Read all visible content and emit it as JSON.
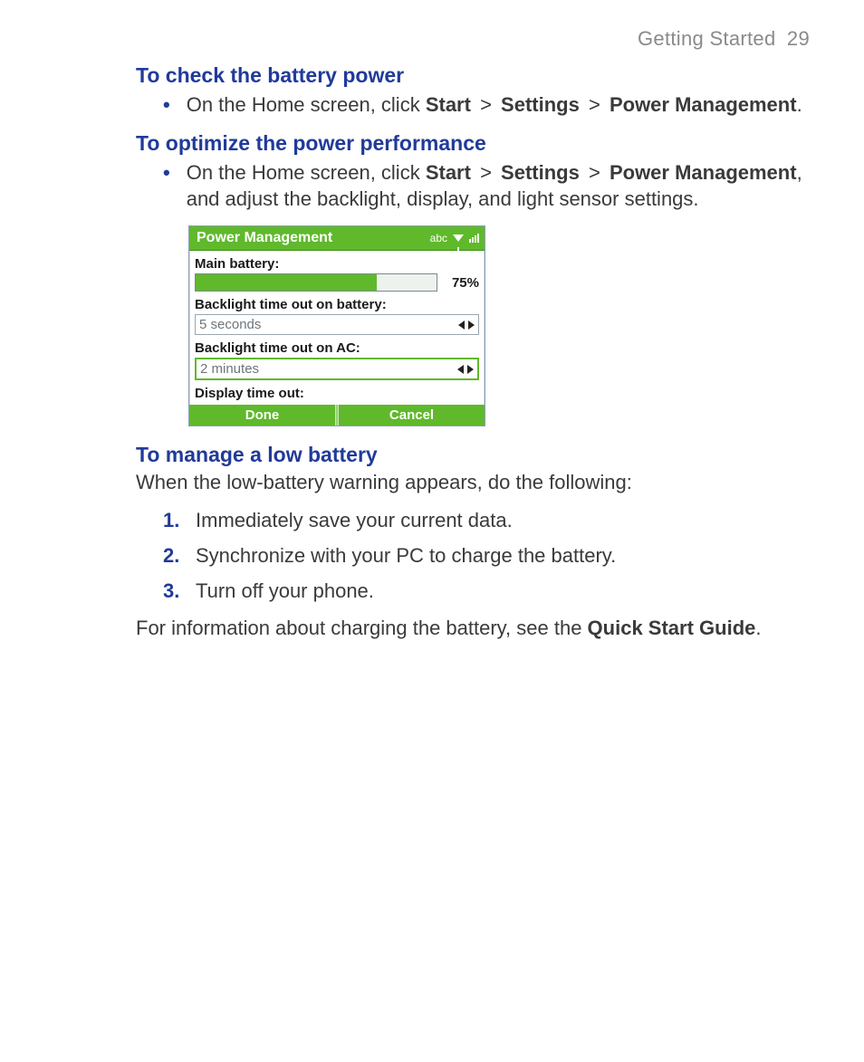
{
  "header": {
    "section": "Getting Started",
    "page": "29"
  },
  "sections": {
    "check": {
      "title": "To check the battery power",
      "bullet_prefix": "On the Home screen, click ",
      "start": "Start",
      "settings": "Settings",
      "power_mgmt": "Power Management",
      "gt": ">",
      "period": "."
    },
    "optimize": {
      "title": "To optimize the power performance",
      "bullet_prefix": "On the Home screen, click ",
      "start": "Start",
      "settings": "Settings",
      "power_mgmt": "Power Management",
      "gt": ">",
      "tail": ", and adjust the backlight, display, and light sensor settings."
    },
    "manage": {
      "title": "To manage a low battery",
      "intro": "When the low-battery warning appears, do the following:",
      "steps": {
        "0": {
          "num": "1.",
          "text": "Immediately save your current data."
        },
        "1": {
          "num": "2.",
          "text": "Synchronize with your PC to charge the battery."
        },
        "2": {
          "num": "3.",
          "text": "Turn off your phone."
        }
      },
      "out_prefix": "For information about charging the battery, see the ",
      "out_bold": "Quick Start Guide",
      "out_suffix": "."
    }
  },
  "device": {
    "title": "Power Management",
    "abc": "abc",
    "main_battery_label": "Main battery:",
    "battery_pct": "75%",
    "backlight_batt_label": "Backlight time out on battery:",
    "backlight_batt_value": "5 seconds",
    "backlight_ac_label": "Backlight time out on AC:",
    "backlight_ac_value": "2 minutes",
    "display_timeout_label": "Display time out:",
    "footer_done": "Done",
    "footer_cancel": "Cancel"
  }
}
